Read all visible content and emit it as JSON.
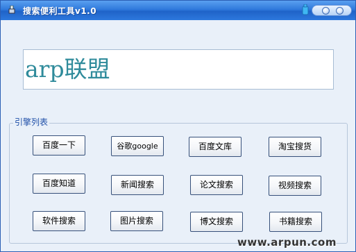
{
  "window": {
    "title": "搜索便利工具v1.0"
  },
  "display": {
    "text": "arp联盟"
  },
  "engines": {
    "legend": "引擎列表",
    "buttons": [
      {
        "label": "百度一下"
      },
      {
        "label": "谷歌google"
      },
      {
        "label": "百度文库"
      },
      {
        "label": "淘宝搜货"
      },
      {
        "label": "百度知道"
      },
      {
        "label": "新闻搜索"
      },
      {
        "label": "论文搜索"
      },
      {
        "label": "视频搜索"
      },
      {
        "label": "软件搜索"
      },
      {
        "label": "图片搜索"
      },
      {
        "label": "博文搜索"
      },
      {
        "label": "书籍搜索"
      }
    ]
  },
  "watermark": {
    "text": "www.arpun.com"
  },
  "colors": {
    "titlebar": "#2f79dc",
    "display_text": "#2f8b9b",
    "legend": "#1f4fa8",
    "window_bg": "#e9f0f9"
  }
}
